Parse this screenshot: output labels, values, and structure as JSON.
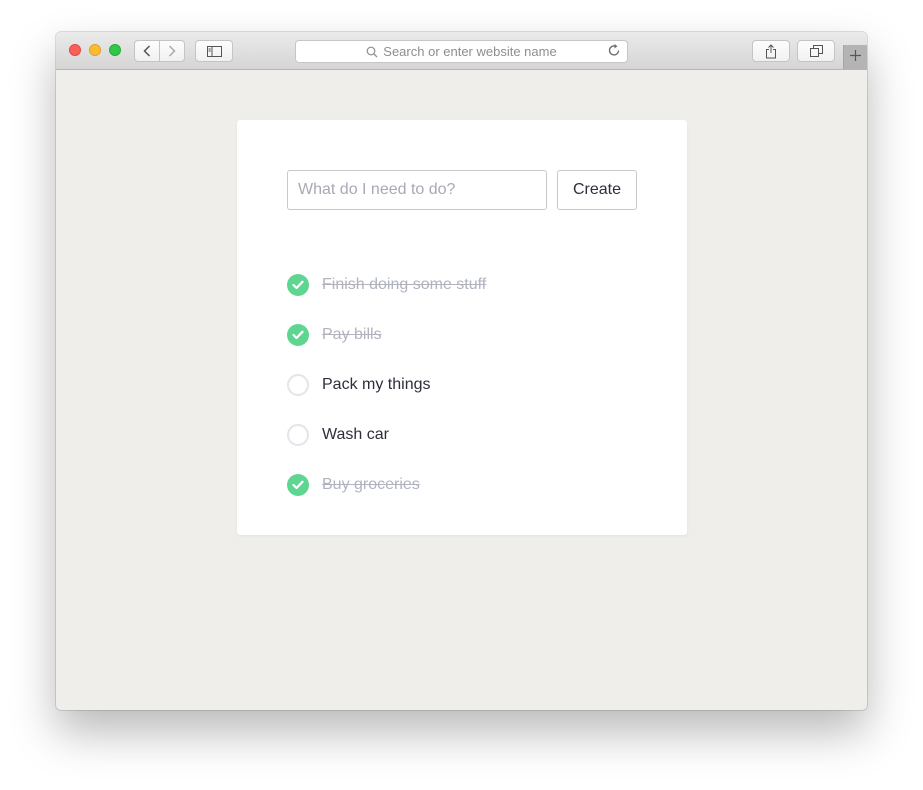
{
  "browser": {
    "address_placeholder": "Search or enter website name",
    "icons": [
      "back-arrow-icon",
      "forward-arrow-icon",
      "sidebar-icon",
      "search-icon",
      "reload-icon",
      "share-icon",
      "tabs-icon",
      "plus-icon"
    ]
  },
  "app": {
    "input_placeholder": "What do I need to do?",
    "create_label": "Create",
    "todos": [
      {
        "text": "Finish doing some stuff",
        "done": true
      },
      {
        "text": "Pay bills",
        "done": true
      },
      {
        "text": "Pack my things",
        "done": false
      },
      {
        "text": "Wash car",
        "done": false
      },
      {
        "text": "Buy groceries",
        "done": true
      }
    ]
  },
  "colors": {
    "done_check": "#5ed692",
    "done_text": "#b1b3bf",
    "text": "#2d2f3b",
    "page_bg": "#efeeea"
  }
}
